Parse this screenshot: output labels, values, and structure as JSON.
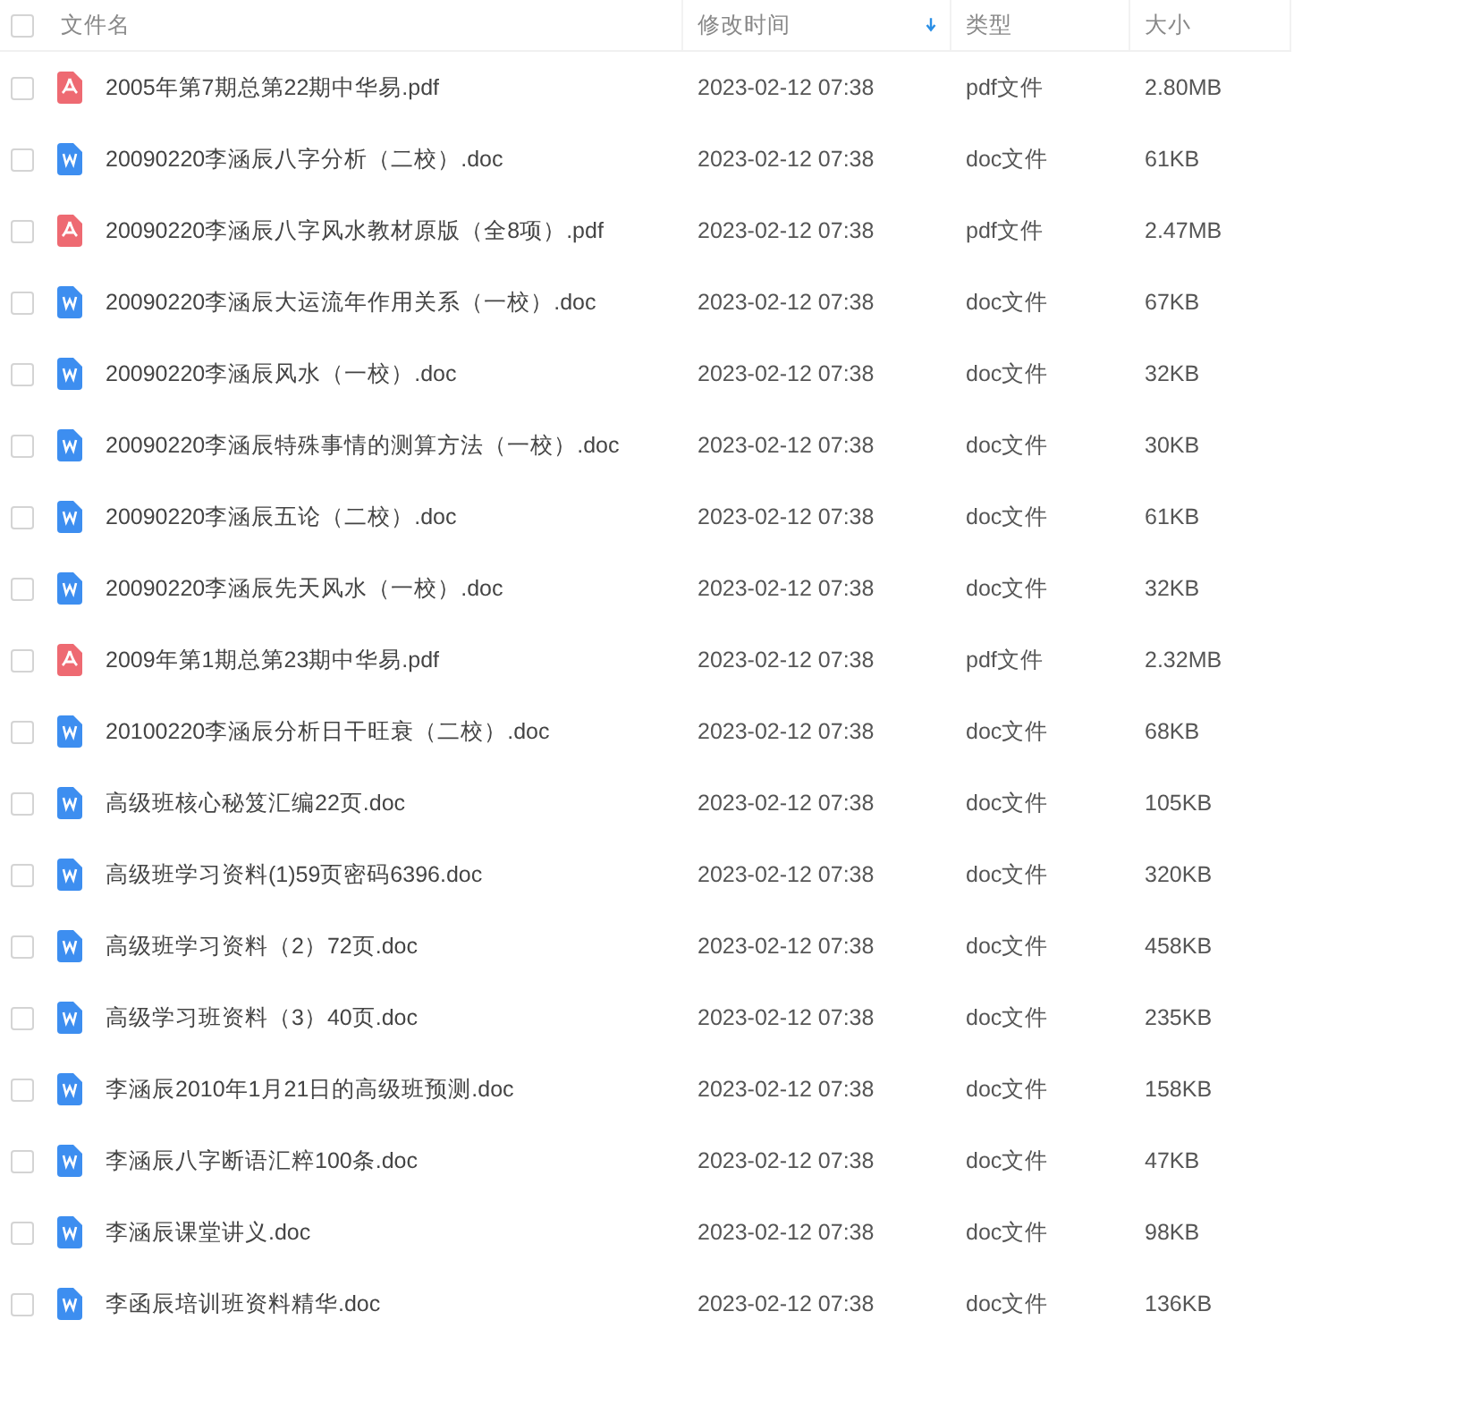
{
  "table": {
    "select_all_checked": false,
    "columns": [
      {
        "label": "文件名",
        "sorted": false
      },
      {
        "label": "修改时间",
        "sorted": true
      },
      {
        "label": "类型",
        "sorted": false
      },
      {
        "label": "大小",
        "sorted": false
      }
    ],
    "rows": [
      {
        "kind": "pdf",
        "checked": false,
        "name": "2005年第7期总第22期中华易.pdf",
        "modified": "2023-02-12 07:38",
        "type": "pdf文件",
        "size": "2.80MB"
      },
      {
        "kind": "doc",
        "checked": false,
        "name": "20090220李涵辰八字分析（二校）.doc",
        "modified": "2023-02-12 07:38",
        "type": "doc文件",
        "size": "61KB"
      },
      {
        "kind": "pdf",
        "checked": false,
        "name": "20090220李涵辰八字风水教材原版（全8项）.pdf",
        "modified": "2023-02-12 07:38",
        "type": "pdf文件",
        "size": "2.47MB"
      },
      {
        "kind": "doc",
        "checked": false,
        "name": "20090220李涵辰大运流年作用关系（一校）.doc",
        "modified": "2023-02-12 07:38",
        "type": "doc文件",
        "size": "67KB"
      },
      {
        "kind": "doc",
        "checked": false,
        "name": "20090220李涵辰风水（一校）.doc",
        "modified": "2023-02-12 07:38",
        "type": "doc文件",
        "size": "32KB"
      },
      {
        "kind": "doc",
        "checked": false,
        "name": "20090220李涵辰特殊事情的测算方法（一校）.doc",
        "modified": "2023-02-12 07:38",
        "type": "doc文件",
        "size": "30KB"
      },
      {
        "kind": "doc",
        "checked": false,
        "name": "20090220李涵辰五论（二校）.doc",
        "modified": "2023-02-12 07:38",
        "type": "doc文件",
        "size": "61KB"
      },
      {
        "kind": "doc",
        "checked": false,
        "name": "20090220李涵辰先天风水（一校）.doc",
        "modified": "2023-02-12 07:38",
        "type": "doc文件",
        "size": "32KB"
      },
      {
        "kind": "pdf",
        "checked": false,
        "name": "2009年第1期总第23期中华易.pdf",
        "modified": "2023-02-12 07:38",
        "type": "pdf文件",
        "size": "2.32MB"
      },
      {
        "kind": "doc",
        "checked": false,
        "name": "20100220李涵辰分析日干旺衰（二校）.doc",
        "modified": "2023-02-12 07:38",
        "type": "doc文件",
        "size": "68KB"
      },
      {
        "kind": "doc",
        "checked": false,
        "name": "高级班核心秘笈汇编22页.doc",
        "modified": "2023-02-12 07:38",
        "type": "doc文件",
        "size": "105KB"
      },
      {
        "kind": "doc",
        "checked": false,
        "name": "高级班学习资料(1)59页密码6396.doc",
        "modified": "2023-02-12 07:38",
        "type": "doc文件",
        "size": "320KB"
      },
      {
        "kind": "doc",
        "checked": false,
        "name": "高级班学习资料（2）72页.doc",
        "modified": "2023-02-12 07:38",
        "type": "doc文件",
        "size": "458KB"
      },
      {
        "kind": "doc",
        "checked": false,
        "name": "高级学习班资料（3）40页.doc",
        "modified": "2023-02-12 07:38",
        "type": "doc文件",
        "size": "235KB"
      },
      {
        "kind": "doc",
        "checked": false,
        "name": "李涵辰2010年1月21日的高级班预测.doc",
        "modified": "2023-02-12 07:38",
        "type": "doc文件",
        "size": "158KB"
      },
      {
        "kind": "doc",
        "checked": false,
        "name": "李涵辰八字断语汇粹100条.doc",
        "modified": "2023-02-12 07:38",
        "type": "doc文件",
        "size": "47KB"
      },
      {
        "kind": "doc",
        "checked": false,
        "name": "李涵辰课堂讲义.doc",
        "modified": "2023-02-12 07:38",
        "type": "doc文件",
        "size": "98KB"
      },
      {
        "kind": "doc",
        "checked": false,
        "name": "李函辰培训班资料精华.doc",
        "modified": "2023-02-12 07:38",
        "type": "doc文件",
        "size": "136KB"
      }
    ]
  }
}
